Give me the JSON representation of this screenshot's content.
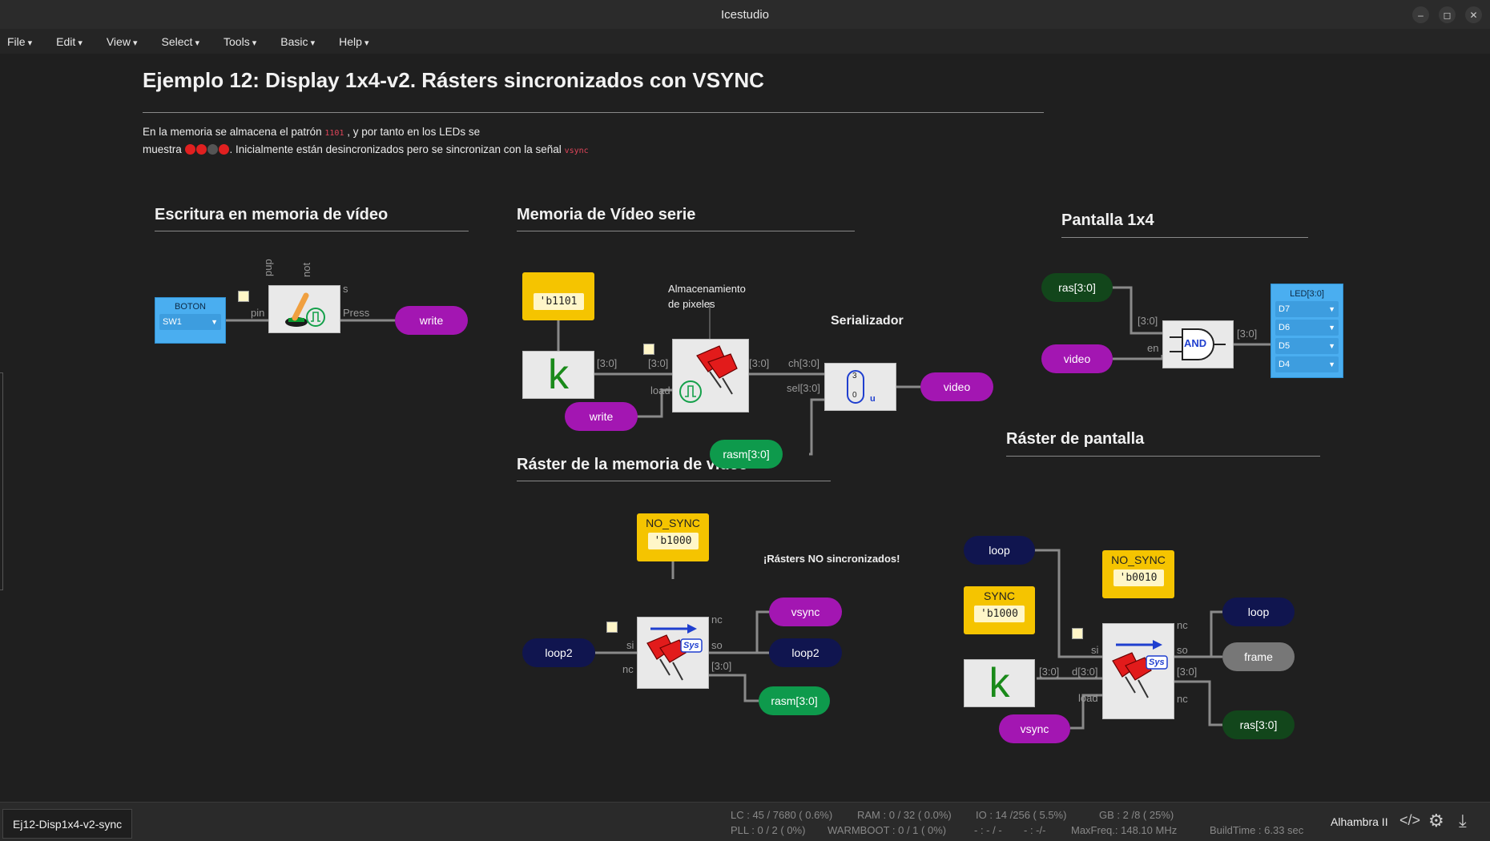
{
  "window": {
    "title": "Icestudio",
    "buttons": [
      "–",
      "◻",
      "✕"
    ]
  },
  "menu": [
    "File",
    "Edit",
    "View",
    "Select",
    "Tools",
    "Basic",
    "Help"
  ],
  "header": {
    "title": "Ejemplo 12: Display 1x4-v2. Rásters sincronizados con VSYNC",
    "desc1_a": "En la memoria se almacena el patrón",
    "desc1_code": "1101",
    "desc1_b": ", y por tanto en los LEDs se",
    "desc2_a": "muestra",
    "desc2_b": ". Inicialmente están desincronizados pero se sincronizan con la señal",
    "desc2_code": "vsync",
    "led_colors": [
      "#e02020",
      "#e02020",
      "#555555",
      "#e02020"
    ]
  },
  "sections": {
    "escritura": "Escritura en memoria de vídeo",
    "memoria": "Memoria de Vídeo serie",
    "pantalla": "Pantalla 1x4",
    "raster_mem": "Ráster de la memoria de vídeo",
    "raster_pant": "Ráster de pantalla"
  },
  "escritura": {
    "boton_title": "BOTON",
    "boton_pin": "SW1",
    "pin_label": "pin",
    "pup": "pup",
    "not": "not",
    "s": "s",
    "press": "Press",
    "write": "write"
  },
  "memoria": {
    "const_value": "'b1101",
    "k": "k",
    "bus1": "[3:0]",
    "bus2": "[3:0]",
    "bus3": "[3:0]",
    "load": "load",
    "write": "write",
    "almac": [
      "Almacenamiento",
      "de pixeles"
    ],
    "serializador": "Serializador",
    "ch": "ch[3:0]",
    "sel": "sel[3:0]",
    "mux_top": "3",
    "mux_bot": "0",
    "mux_u": "u",
    "video": "video",
    "rasm": "rasm[3:0]"
  },
  "pantalla": {
    "ras": "ras[3:0]",
    "video": "video",
    "bus_in": "[3:0]",
    "en": "en",
    "and": "AND",
    "bus_out": "[3:0]",
    "led_title": "LED[3:0]",
    "leds": [
      "D7",
      "D6",
      "D5",
      "D4"
    ]
  },
  "raster_mem": {
    "const_name": "NO_SYNC",
    "const_value": "'b1000",
    "note": "¡Rásters NO sincronizados!",
    "si": "si",
    "nc_left": "nc",
    "nc_top": "nc",
    "so": "so",
    "bus": "[3:0]",
    "sys": "Sys",
    "loop2_in": "loop2",
    "vsync": "vsync",
    "loop2_out": "loop2",
    "rasm": "rasm[3:0]"
  },
  "raster_pant": {
    "loop": "loop",
    "sync_name": "SYNC",
    "sync_value": "'b1000",
    "nosync_name": "NO_SYNC",
    "nosync_value": "'b0010",
    "k": "k",
    "bus_k": "[3:0]",
    "d": "d[3:0]",
    "load": "load",
    "si": "si",
    "nc_top": "nc",
    "so": "so",
    "bus_out": "[3:0]",
    "nc_bot": "nc",
    "sys": "Sys",
    "vsync": "vsync",
    "loop_out": "loop",
    "frame": "frame",
    "ras": "ras[3:0]"
  },
  "statusbar": {
    "project": "Ej12-Disp1x4-v2-sync",
    "lc": "LC : 45 / 7680 ( 0.6%)",
    "ram": "RAM : 0 / 32 ( 0.0%)",
    "io": "IO : 14 /256  ( 5.5%)",
    "gb": "GB : 2 /8  ( 25%)",
    "pll": "PLL : 0 / 2 ( 0%)",
    "warmboot": "WARMBOOT : 0 / 1 ( 0%)",
    "blank1": "- : - / -",
    "blank2": "- : -/-",
    "maxfreq": "MaxFreq.: 148.10 MHz",
    "buildtime": "BuildTime : 6.33 sec",
    "board": "Alhambra II"
  }
}
